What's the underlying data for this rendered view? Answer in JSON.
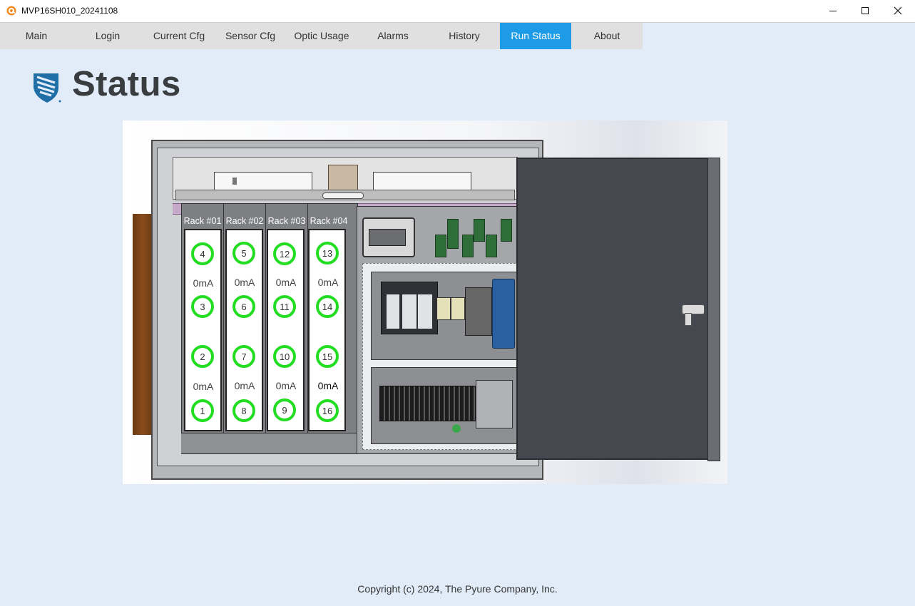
{
  "window": {
    "title": "MVP16SH010_20241108",
    "icon": "app-icon"
  },
  "menu": {
    "tabs": [
      "Main",
      "Login",
      "Current Cfg",
      "Sensor Cfg",
      "Optic Usage",
      "Alarms",
      "History",
      "Run Status",
      "About"
    ],
    "active_tab": "Run Status"
  },
  "page": {
    "title": "Status"
  },
  "racks": [
    {
      "label": "Rack #01",
      "top_sensors": [
        "4",
        "3"
      ],
      "top_current": "0mA",
      "bottom_sensors": [
        "2",
        "1"
      ],
      "bottom_current": "0mA"
    },
    {
      "label": "Rack #02",
      "top_sensors": [
        "5",
        "6"
      ],
      "top_current": "0mA",
      "bottom_sensors": [
        "7",
        "8"
      ],
      "bottom_current": "0mA"
    },
    {
      "label": "Rack #03",
      "top_sensors": [
        "12",
        "11"
      ],
      "top_current": "0mA",
      "bottom_sensors": [
        "10",
        "9"
      ],
      "bottom_current": "0mA"
    },
    {
      "label": "Rack #04",
      "top_sensors": [
        "13",
        "14"
      ],
      "top_current": "0mA",
      "bottom_sensors": [
        "15",
        "16"
      ],
      "bottom_current": "0mA"
    }
  ],
  "sensor_status_color": "#22dd22",
  "accent_color": "#1e9be6",
  "footer": {
    "copyright": "Copyright (c) 2024, The Pyure Company, Inc."
  }
}
